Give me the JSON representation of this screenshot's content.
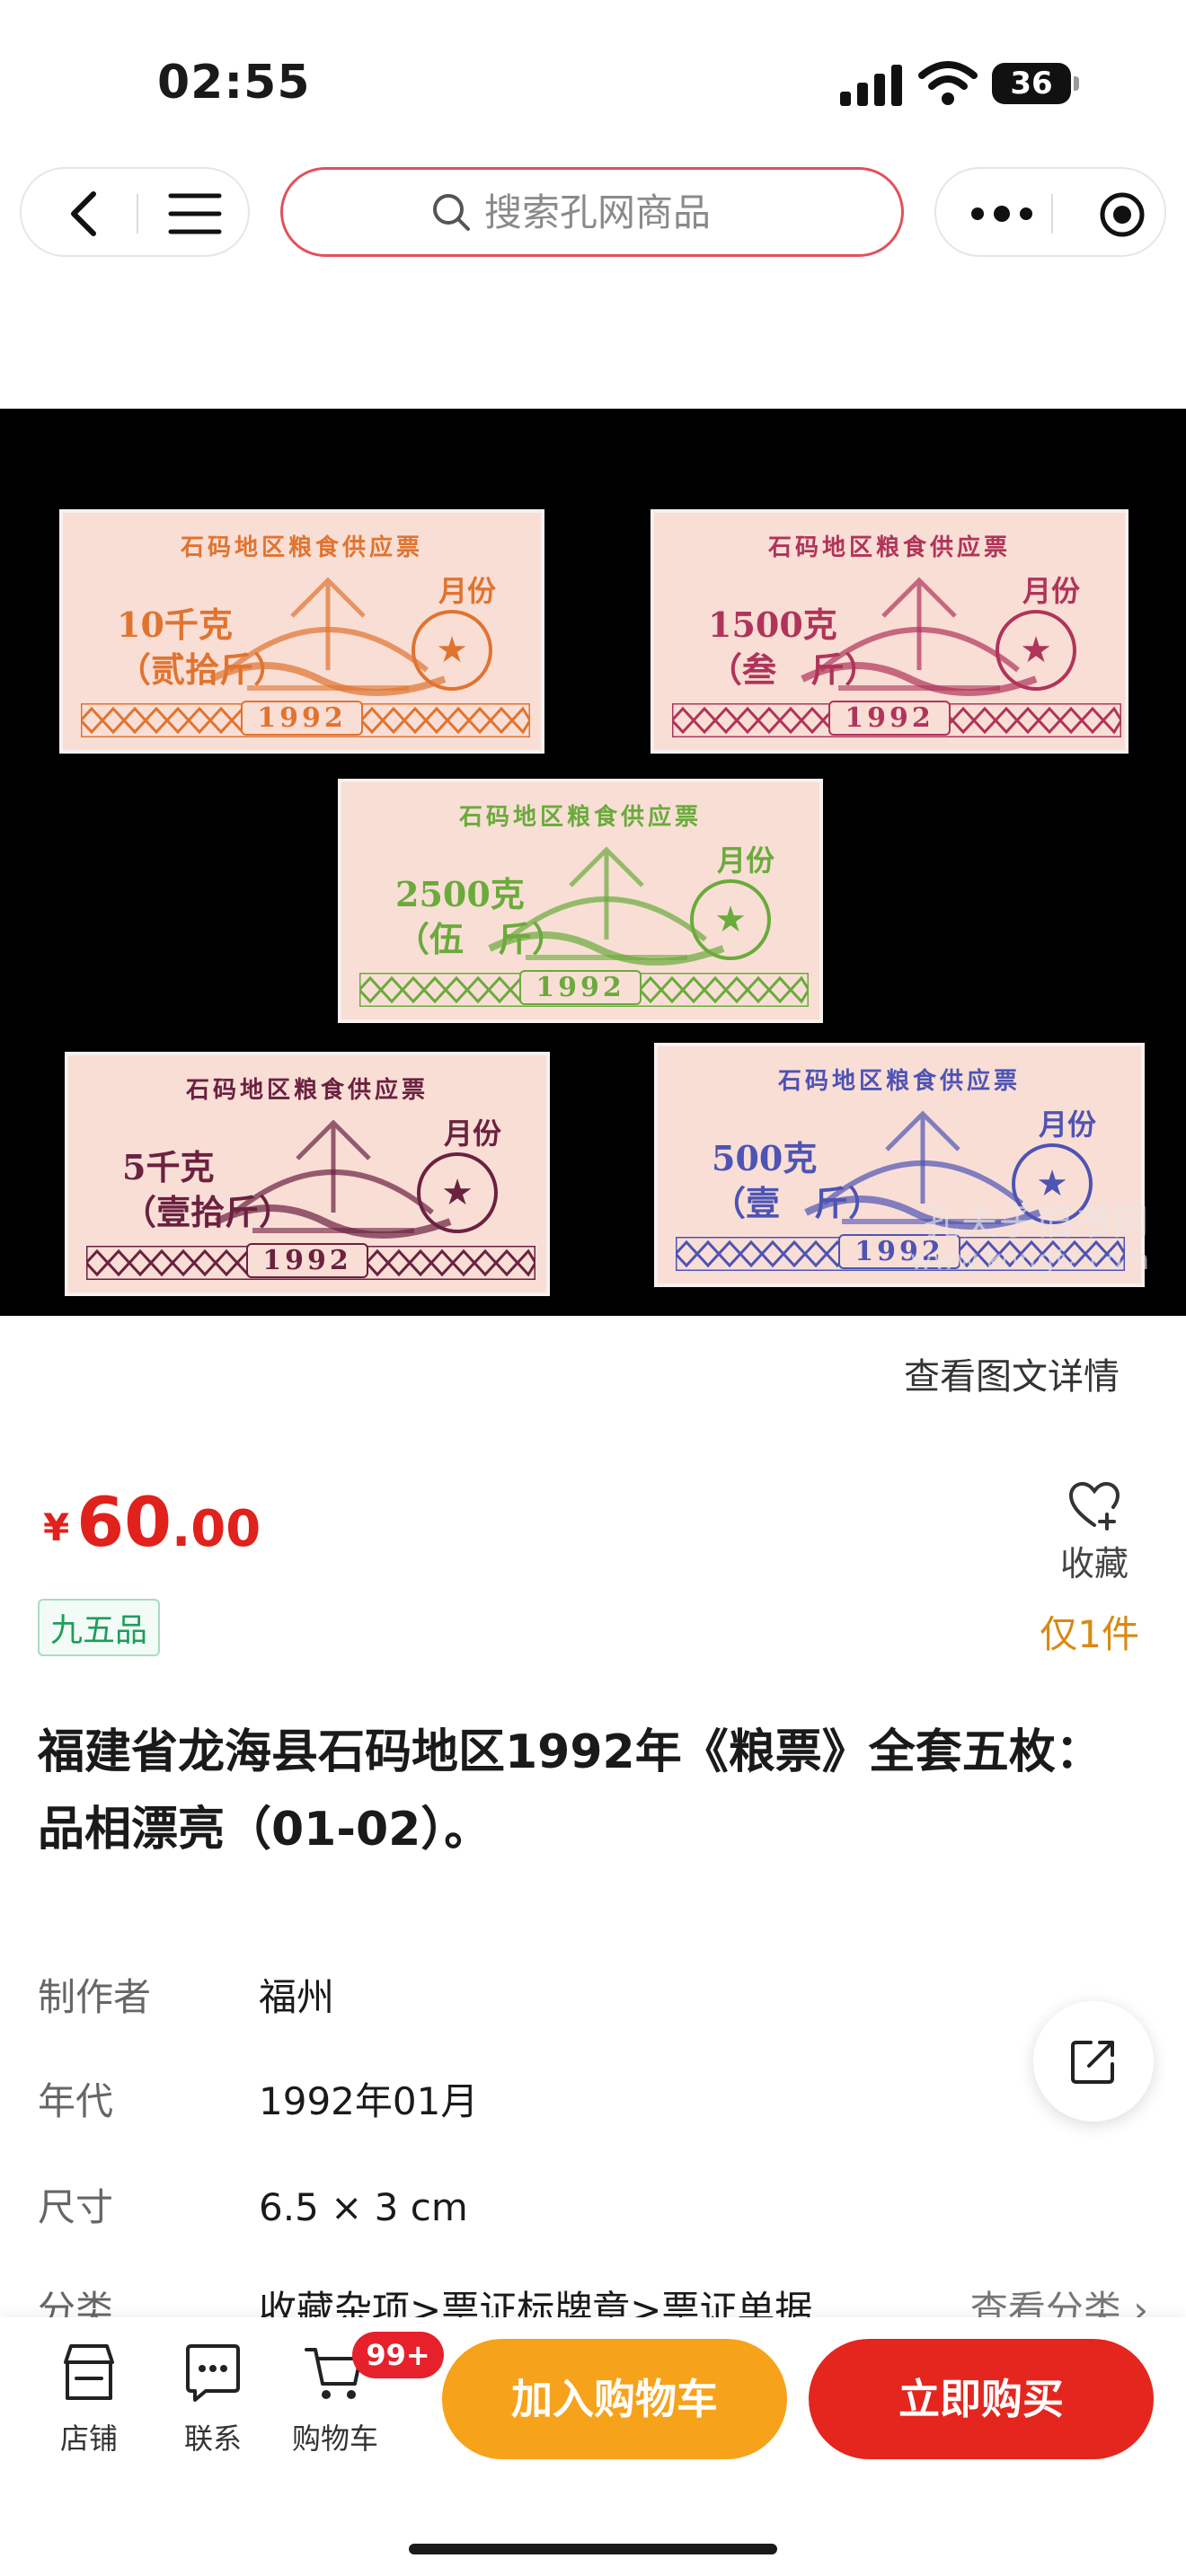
{
  "status_bar": {
    "time": "02:55",
    "battery": "36"
  },
  "search": {
    "placeholder": "搜索孔网商品"
  },
  "product_image": {
    "tickets": [
      {
        "title": "石码地区粮食供应票",
        "month": "月份",
        "amount_line1": "10千克",
        "amount_line2": "（贰拾斤）",
        "year": "1992",
        "color": "#e0742f"
      },
      {
        "title": "石码地区粮食供应票",
        "month": "月份",
        "amount_line1": "1500克",
        "amount_line2": "（叁　斤）",
        "year": "1992",
        "color": "#b0345a"
      },
      {
        "title": "石码地区粮食供应票",
        "month": "月份",
        "amount_line1": "2500克",
        "amount_line2": "（伍　斤）",
        "year": "1992",
        "color": "#6aab3b"
      },
      {
        "title": "石码地区粮食供应票",
        "month": "月份",
        "amount_line1": "5千克",
        "amount_line2": "（壹拾斤）",
        "year": "1992",
        "color": "#6b2140"
      },
      {
        "title": "石码地区粮食供应票",
        "month": "月份",
        "amount_line1": "500克",
        "amount_line2": "（壹　斤）",
        "year": "1992",
        "color": "#4e54b4"
      }
    ],
    "watermark_line1": "孔夫子旧书网",
    "watermark_line2": "www.kongfz.com"
  },
  "detail_link": "查看图文详情",
  "price": {
    "currency": "¥",
    "integer": "60",
    "decimal": ".00"
  },
  "favorite_label": "收藏",
  "condition": "九五品",
  "stock": "仅1件",
  "title": "福建省龙海县石码地区1992年《粮票》全套五枚：品相漂亮（01-02）。",
  "attributes": [
    {
      "key": "制作者",
      "value": "福州"
    },
    {
      "key": "年代",
      "value": "1992年01月"
    },
    {
      "key": "尺寸",
      "value": "6.5 × 3 cm"
    },
    {
      "key": "分类",
      "value": "收藏杂项>票证标牌章>票证单据",
      "link": "查看分类 ›"
    }
  ],
  "bottom_bar": {
    "store": "店铺",
    "contact": "联系",
    "cart": "购物车",
    "cart_badge": "99+",
    "add_to_cart": "加入购物车",
    "buy_now": "立即购买"
  },
  "colors": {
    "accent_red": "#e4261e",
    "accent_orange": "#f7a21b",
    "price_red": "#e0211c",
    "stock_gold": "#d88a12",
    "condition_green": "#1e9e5a"
  }
}
